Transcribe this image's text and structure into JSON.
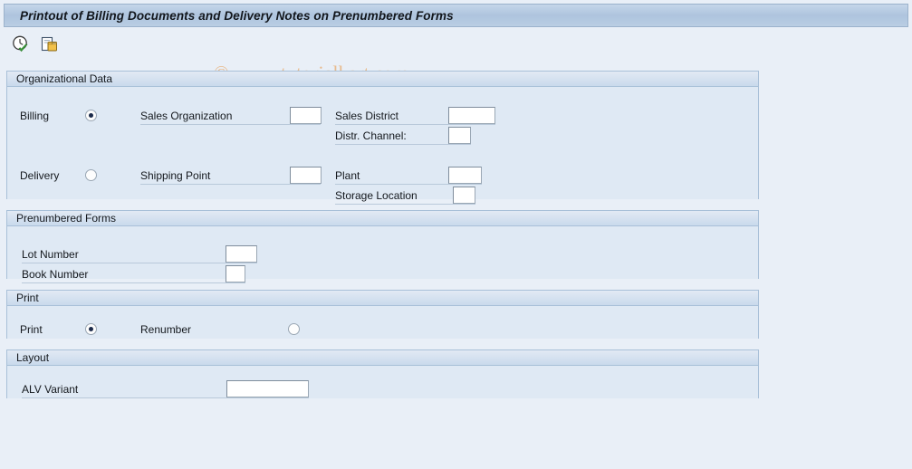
{
  "window": {
    "title": "Printout of Billing Documents and Delivery Notes on Prenumbered Forms"
  },
  "toolbar": {
    "icons": [
      {
        "name": "execute-clock-check-icon",
        "title": "Execute"
      },
      {
        "name": "copy-documents-icon",
        "title": "Get Variant"
      }
    ]
  },
  "watermark": {
    "text": "© www.tutorialkart.com",
    "color": "#e8bb8e"
  },
  "panels": {
    "organizational_data": {
      "header": "Organizational Data",
      "billing_label": "Billing",
      "billing_selected": true,
      "delivery_label": "Delivery",
      "delivery_selected": false,
      "fields": {
        "sales_organization": {
          "label": "Sales Organization",
          "value": ""
        },
        "sales_district": {
          "label": "Sales District",
          "value": ""
        },
        "distr_channel": {
          "label": "Distr. Channel:",
          "value": ""
        },
        "shipping_point": {
          "label": "Shipping Point",
          "value": ""
        },
        "plant": {
          "label": "Plant",
          "value": ""
        },
        "storage_location": {
          "label": "Storage Location",
          "value": ""
        }
      }
    },
    "prenumbered_forms": {
      "header": "Prenumbered Forms",
      "fields": {
        "lot_number": {
          "label": "Lot Number",
          "value": ""
        },
        "book_number": {
          "label": "Book Number",
          "value": ""
        }
      }
    },
    "print": {
      "header": "Print",
      "print_label": "Print",
      "print_selected": true,
      "renumber_label": "Renumber",
      "renumber_selected": false
    },
    "layout": {
      "header": "Layout",
      "fields": {
        "alv_variant": {
          "label": "ALV Variant",
          "value": ""
        }
      }
    }
  },
  "colors": {
    "page_background": "#e9eff7",
    "panel_background": "#dfe9f4",
    "panel_border": "#a8c0d8",
    "titlebar": "#aec4de",
    "accent_text": "#14181d"
  }
}
